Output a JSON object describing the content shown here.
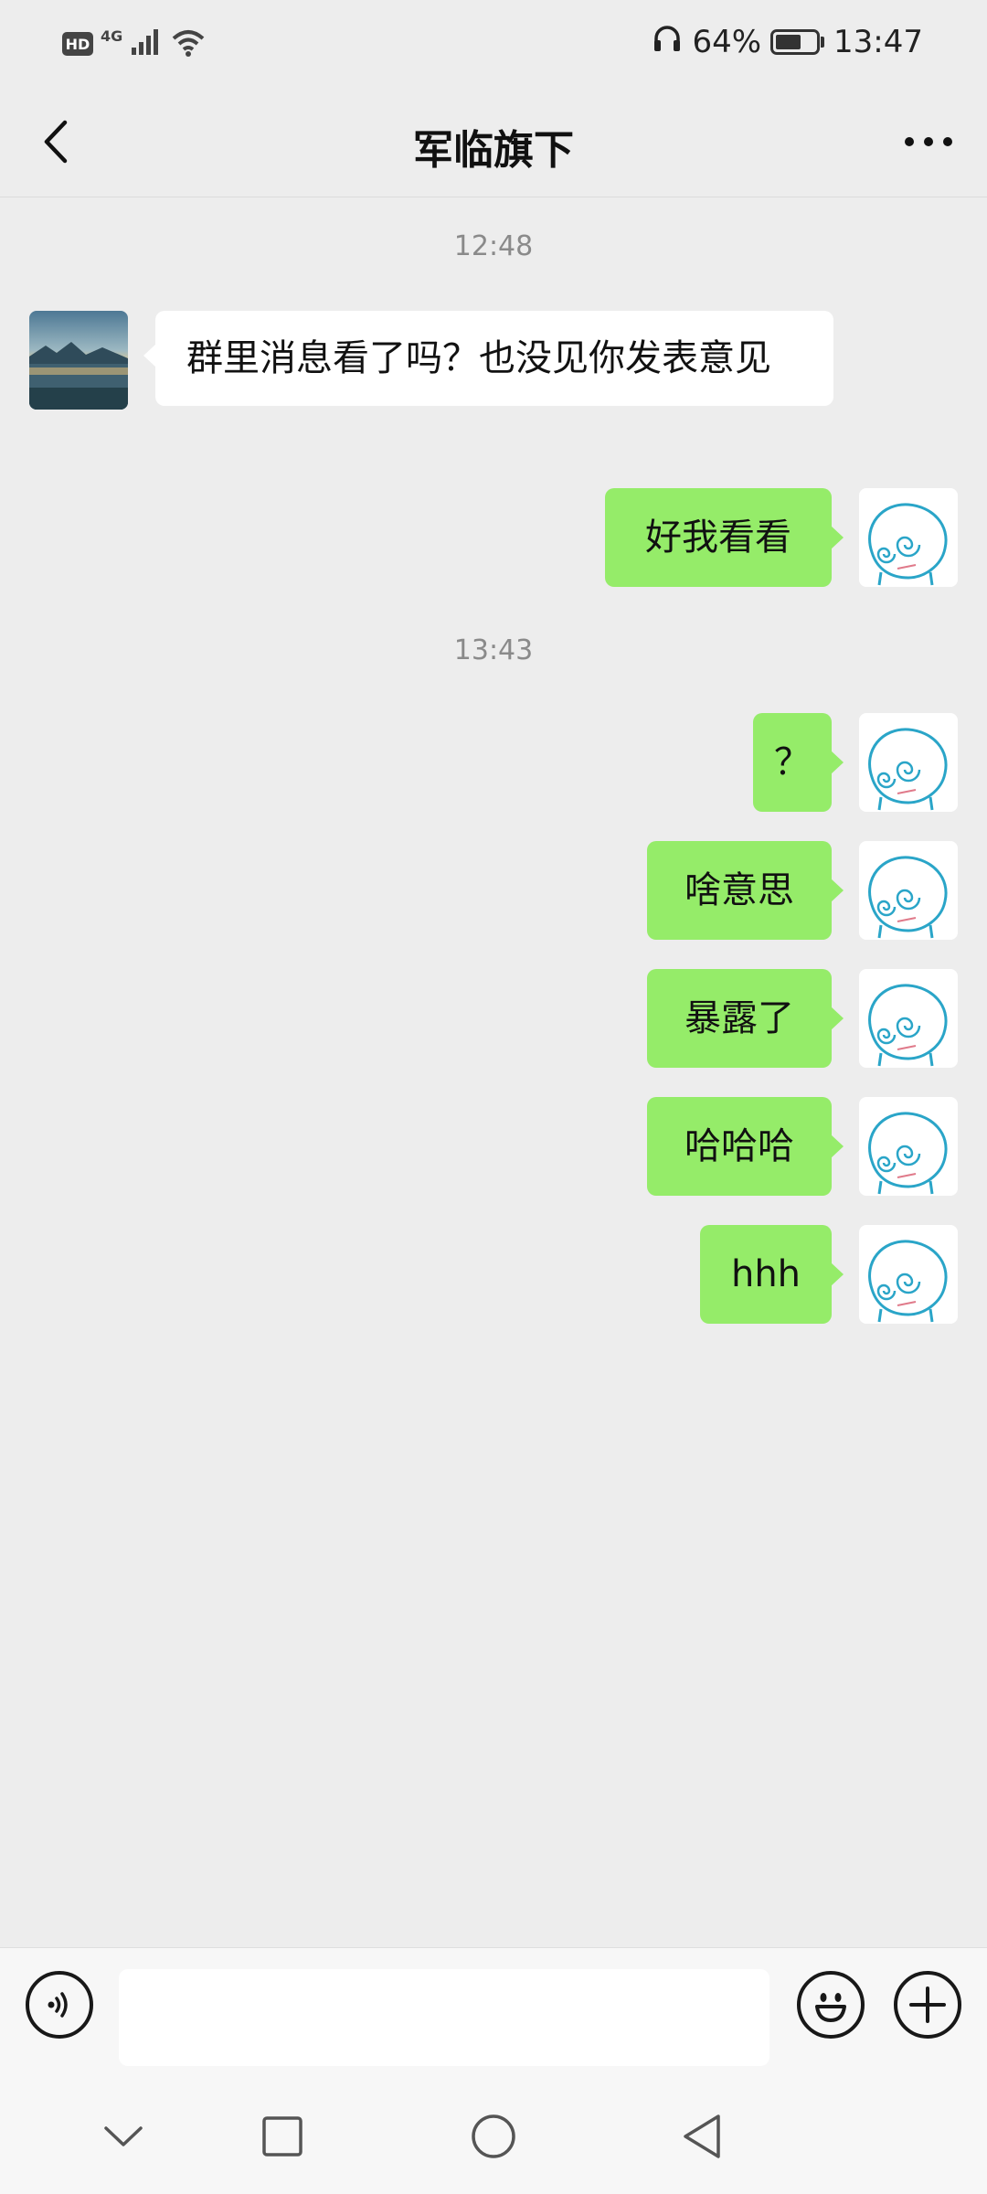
{
  "status_bar": {
    "hd_label": "HD",
    "network_label": "4G",
    "battery_percent": "64%",
    "battery_level": 0.64,
    "time": "13:47",
    "icons": [
      "signal-icon",
      "wifi-icon",
      "headphones-icon",
      "battery-icon"
    ]
  },
  "header": {
    "title": "军临旗下",
    "back_icon": "chevron-left-icon",
    "more_icon": "more-dots-icon"
  },
  "messages": {
    "timestamp_1": "12:48",
    "msg_1": "群里消息看了吗？也没见你发表意见",
    "msg_2": "好我看看",
    "timestamp_2": "13:43",
    "msg_3": "？",
    "msg_4": "啥意思",
    "msg_5": "暴露了",
    "msg_6": "哈哈哈",
    "msg_7": "hhh"
  },
  "input_bar": {
    "voice_icon": "voice-icon",
    "text_value": "",
    "emoji_icon": "emoji-icon",
    "plus_icon": "plus-icon"
  },
  "colors": {
    "background": "#ededed",
    "sent_bubble": "#95ec69",
    "received_bubble": "#ffffff",
    "timestamp": "#8a8a8a"
  }
}
